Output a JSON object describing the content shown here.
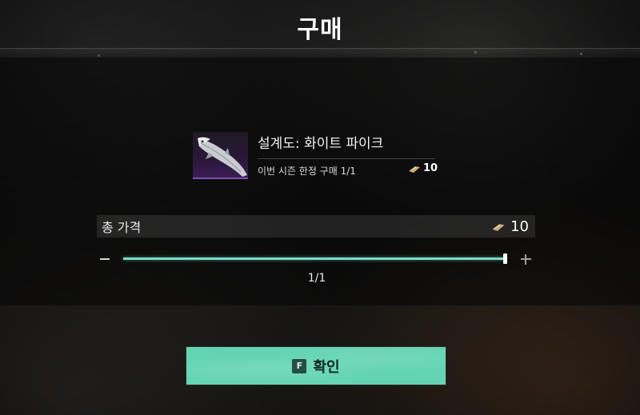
{
  "dialog": {
    "title": "구매"
  },
  "item": {
    "name": "설계도: 화이트 파이크",
    "limit_text": "이번 시즌 한정 구매 1/1",
    "price": "10",
    "currency_icon": "ingot-currency-icon",
    "thumbnail_icon": "white-pike-fish-icon",
    "rarity_color": "#7b4fb0"
  },
  "total": {
    "label": "총 가격",
    "price": "10",
    "currency_icon": "ingot-currency-icon"
  },
  "quantity": {
    "text": "1/1",
    "current": 1,
    "max": 1,
    "fill_fraction": 1.0
  },
  "confirm": {
    "key": "F",
    "label": "확인",
    "color": "#64d4b3"
  },
  "colors": {
    "accent": "#78dbc3"
  }
}
